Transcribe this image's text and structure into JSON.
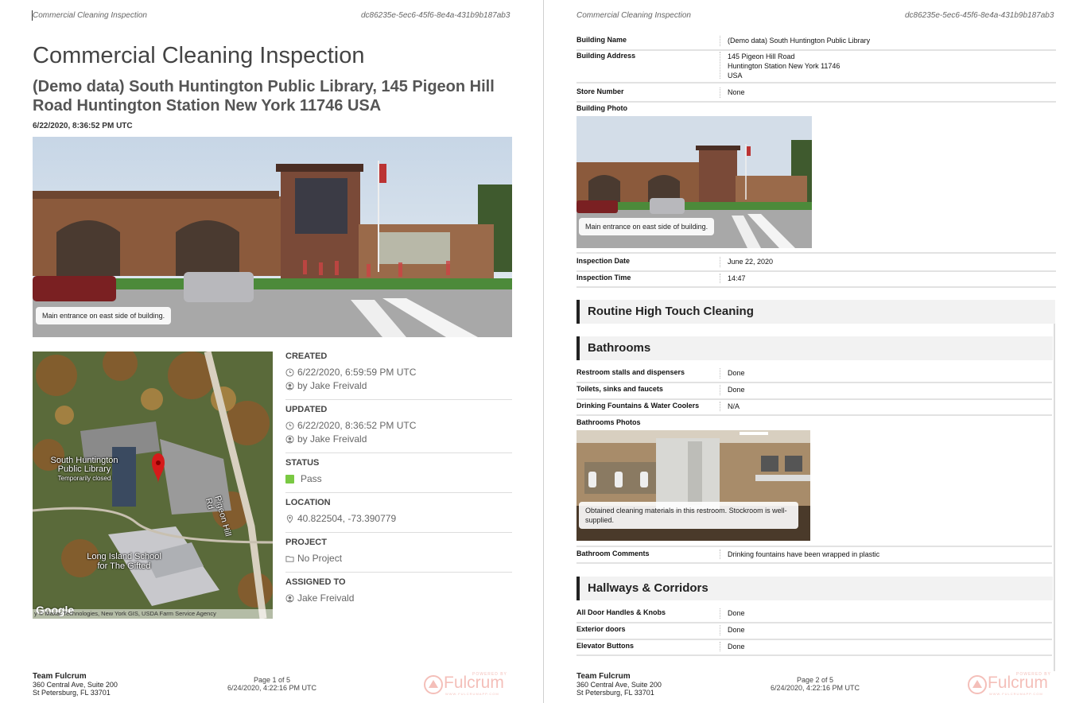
{
  "doc": {
    "header_title": "Commercial Cleaning Inspection",
    "header_id": "dc86235e-5ec6-45f6-8e4a-431b9b187ab3"
  },
  "page1": {
    "title": "Commercial Cleaning Inspection",
    "subtitle": "(Demo data) South Huntington Public Library, 145 Pigeon Hill Road Huntington Station New York 11746 USA",
    "timestamp": "6/22/2020, 8:36:52 PM UTC",
    "photo_caption": "Main entrance on east side of building.",
    "map": {
      "place_name_1": "South Huntington",
      "place_name_2": "Public Library",
      "place_note": "Temporarily closed",
      "school_1": "Long Island School",
      "school_2": "for The Gifted",
      "road": "Pigeon Hill Rd",
      "google": "Google",
      "attribution": "y © Maxar Technologies, New York GIS, USDA Farm Service Agency"
    },
    "meta": {
      "created_label": "CREATED",
      "created_time": "6/22/2020, 6:59:59 PM UTC",
      "created_by": "by Jake Freivald",
      "updated_label": "UPDATED",
      "updated_time": "6/22/2020, 8:36:52 PM UTC",
      "updated_by": "by Jake Freivald",
      "status_label": "STATUS",
      "status_value": "Pass",
      "status_color": "#7ac943",
      "location_label": "LOCATION",
      "location_value": "40.822504, -73.390779",
      "project_label": "PROJECT",
      "project_value": "No Project",
      "assigned_label": "ASSIGNED TO",
      "assigned_value": "Jake Freivald"
    },
    "page_num": "Page 1 of 5"
  },
  "footer": {
    "org_name": "Team Fulcrum",
    "org_addr1": "360 Central Ave, Suite 200",
    "org_addr2": "St Petersburg, FL 33701",
    "printed": "6/24/2020, 4:22:16 PM UTC",
    "logo_text": "Fulcrum",
    "logo_powered": "POWERED BY",
    "logo_url": "WWW.FULCRUMAPP.COM",
    "brand_color": "#e04a3a"
  },
  "page2": {
    "building_name_label": "Building Name",
    "building_name": "(Demo data) South Huntington Public Library",
    "building_address_label": "Building Address",
    "address_line1": "145 Pigeon Hill Road",
    "address_line2": "Huntington Station New York 11746",
    "address_line3": "USA",
    "store_number_label": "Store Number",
    "store_number": "None",
    "building_photo_label": "Building Photo",
    "building_photo_caption": "Main entrance on east side of building.",
    "inspection_date_label": "Inspection Date",
    "inspection_date": "June 22, 2020",
    "inspection_time_label": "Inspection Time",
    "inspection_time": "14:47",
    "section_routine": "Routine High Touch Cleaning",
    "section_bathrooms": "Bathrooms",
    "bath_rows": [
      {
        "label": "Restroom stalls and dispensers",
        "value": "Done"
      },
      {
        "label": "Toilets, sinks and faucets",
        "value": "Done"
      },
      {
        "label": "Drinking Fountains & Water Coolers",
        "value": "N/A"
      }
    ],
    "bath_photos_label": "Bathrooms Photos",
    "bath_photo_caption": "Obtained cleaning materials in this restroom. Stockroom is well-supplied.",
    "bath_comments_label": "Bathroom Comments",
    "bath_comments": "Drinking fountains have been wrapped in plastic",
    "section_hallways": "Hallways & Corridors",
    "hall_rows": [
      {
        "label": "All Door Handles & Knobs",
        "value": "Done"
      },
      {
        "label": "Exterior doors",
        "value": "Done"
      },
      {
        "label": "Elevator Buttons",
        "value": "Done"
      }
    ],
    "page_num": "Page 2 of 5"
  }
}
